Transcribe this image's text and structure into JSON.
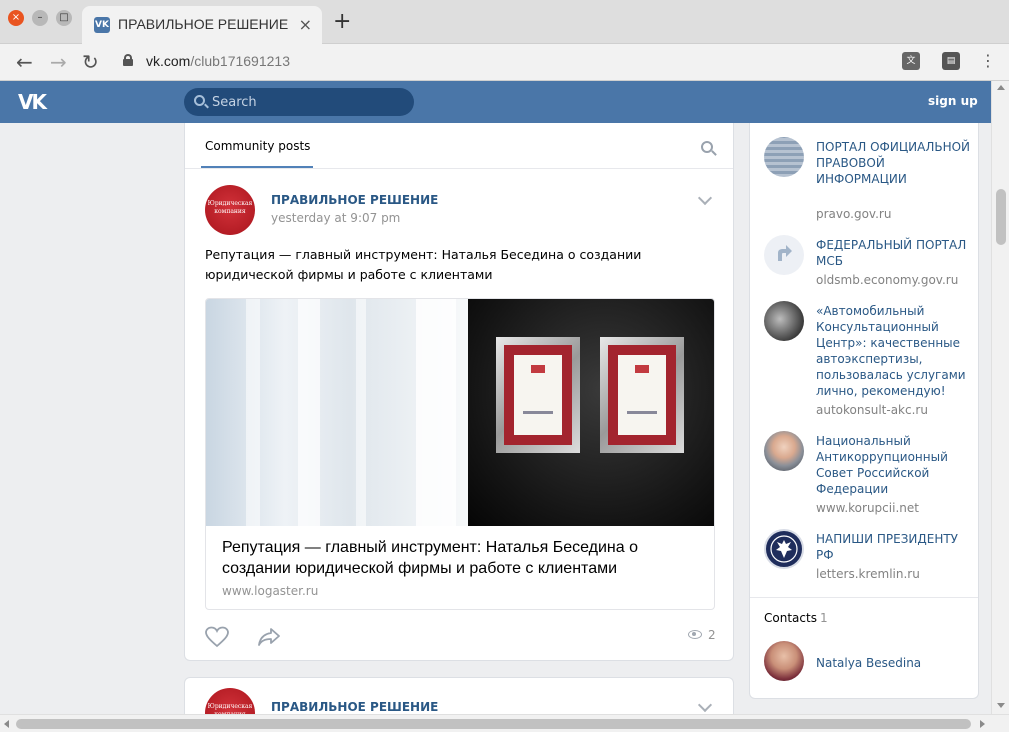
{
  "browser": {
    "tab_title": "ПРАВИЛЬНОЕ РЕШЕНИЕ",
    "tab_favicon": "VK",
    "url_domain": "vk.com",
    "url_path": "/club171691213"
  },
  "header": {
    "logo": "VK",
    "search_placeholder": "Search",
    "signup_label": "sign up"
  },
  "posts": {
    "tab_label": "Community posts",
    "items": [
      {
        "author": "ПРАВИЛЬНОЕ РЕШЕНИЕ",
        "time": "yesterday at 9:07 pm",
        "avatar_text": "Юридическая компания",
        "text": "Репутация — главный инструмент: Наталья Беседина о создании юридической фирмы и работе с клиентами",
        "attachment": {
          "title": "Репутация — главный инструмент: Наталья Беседина о создании юридической фирмы и работе с клиентами",
          "domain": "www.logaster.ru"
        },
        "views": "2"
      },
      {
        "author": "ПРАВИЛЬНОЕ РЕШЕНИЕ",
        "avatar_text": "Юридическая компания"
      }
    ]
  },
  "sidebar": {
    "links": [
      {
        "title": "ПОРТАЛ ОФИЦИАЛЬНОЙ ПРАВОВОЙ ИНФОРМАЦИИ",
        "url": "pravo.gov.ru"
      },
      {
        "title": "ФЕДЕРАЛЬНЫЙ ПОРТАЛ МСБ",
        "url": "oldsmb.economy.gov.ru"
      },
      {
        "title": "«Автомобильный Консультационный Центр»: качественные автоэкспертизы, пользовалась услугами лично, рекомендую!",
        "url": "autokonsult-akc.ru"
      },
      {
        "title": "Национальный Антикоррупционный Совет Российской Федерации",
        "url": "www.korupcii.net"
      },
      {
        "title": "НАПИШИ ПРЕЗИДЕНТУ РФ",
        "url": "letters.kremlin.ru"
      }
    ],
    "contacts_label": "Contacts",
    "contacts_count": "1",
    "contact_name": "Natalya Besedina"
  },
  "colors": {
    "vk_blue": "#4a76a8",
    "link_blue": "#2a5885",
    "brand_red": "#b51d25"
  }
}
